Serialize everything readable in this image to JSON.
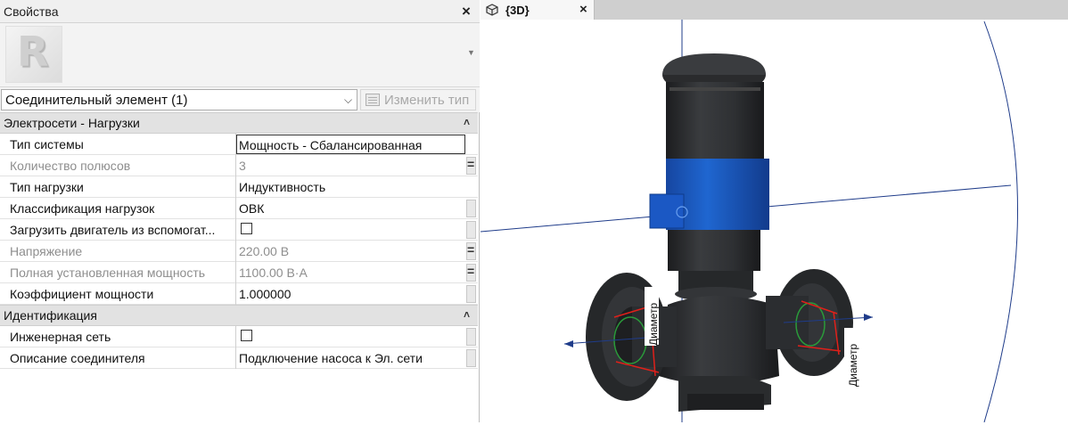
{
  "properties_panel": {
    "title": "Свойства",
    "close_symbol": "×",
    "type_thumbnail_letter": "R",
    "type_selector": {
      "value": "Соединительный элемент (1)"
    },
    "edit_type_label": "Изменить тип",
    "groups": [
      {
        "title": "Электросети - Нагрузки",
        "rows": [
          {
            "name": "Тип системы",
            "value": "Мощность - Сбалансированная"
          },
          {
            "name": "Количество полюсов",
            "value": "3"
          },
          {
            "name": "Тип нагрузки",
            "value": "Индуктивность"
          },
          {
            "name": "Классификация нагрузок",
            "value": "ОВК"
          },
          {
            "name": "Загрузить двигатель из вспомогат...",
            "value": ""
          },
          {
            "name": "Напряжение",
            "value": "220.00 В"
          },
          {
            "name": "Полная установленная мощность",
            "value": "1100.00 В·А"
          },
          {
            "name": "Коэффициент мощности",
            "value": "1.000000"
          }
        ]
      },
      {
        "title": "Идентификация",
        "rows": [
          {
            "name": "Инженерная сеть",
            "value": ""
          },
          {
            "name": "Описание соединителя",
            "value": "Подключение насоса к Эл. сети"
          }
        ]
      }
    ]
  },
  "view_tab": {
    "title": "{3D}",
    "close_symbol": "×",
    "icon": "3d-view-icon"
  },
  "view": {
    "dimension_label_left": "Диаметр",
    "dimension_label_right": "Диаметр"
  },
  "colors": {
    "pump_body": "#2e3032",
    "motor_band": "#1d5fc2",
    "axis_line": "#1f3c8a",
    "dimension_red": "#e0201a",
    "connector_green": "#2a9a3a"
  }
}
